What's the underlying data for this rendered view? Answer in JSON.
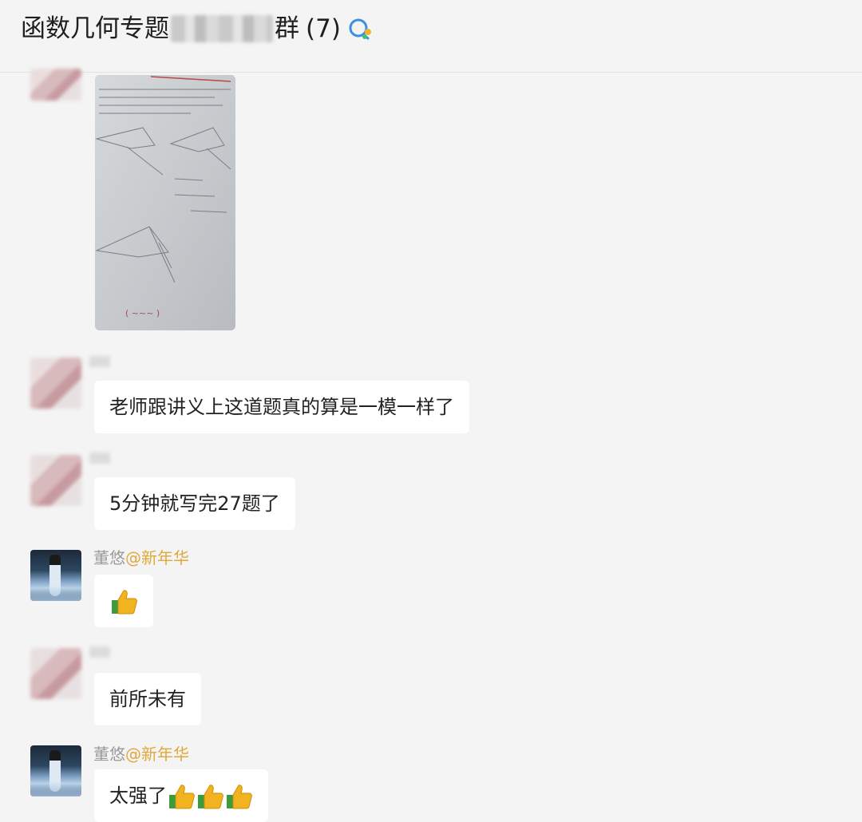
{
  "header": {
    "title_prefix": "函数几何专题",
    "title_suffix": "群",
    "member_count": "(7)",
    "icon": "group-chat-icon"
  },
  "messages": [
    {
      "type": "image",
      "sender_visible": false,
      "icon": "blurred-avatar"
    },
    {
      "type": "text",
      "text": "老师跟讲义上这道题真的算是一模一样了"
    },
    {
      "type": "text",
      "text": "5分钟就写完27题了"
    },
    {
      "type": "emoji",
      "sender": "董悠",
      "mention": "@新年华",
      "emoji": "thumbs-up-icon"
    },
    {
      "type": "text",
      "text": "前所未有"
    },
    {
      "type": "text",
      "sender": "董悠",
      "mention": "@新年华",
      "text": "太强了",
      "emoji_count": 3,
      "emoji": "thumbs-up-icon"
    }
  ],
  "colors": {
    "background": "#f4f4f4",
    "bubble": "#ffffff",
    "mention": "#e0a83a",
    "sender": "#9a9a9a"
  }
}
